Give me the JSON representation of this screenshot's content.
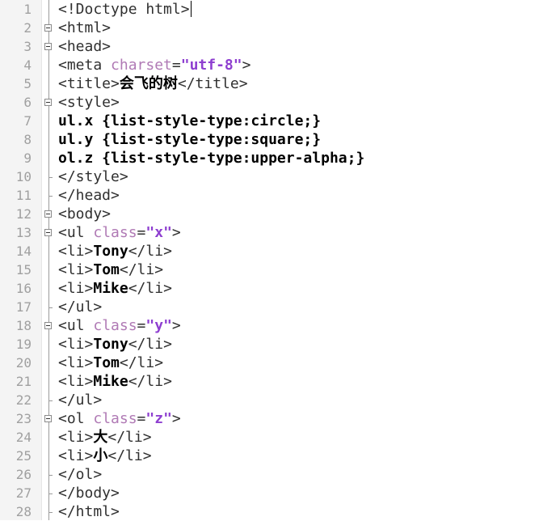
{
  "editor": {
    "lines": [
      {
        "n": "1",
        "parts": [
          {
            "t": "<!Doctype html>",
            "c": "tag"
          }
        ],
        "cursor": true
      },
      {
        "n": "2",
        "parts": [
          {
            "t": "<html>",
            "c": "tag"
          }
        ]
      },
      {
        "n": "3",
        "parts": [
          {
            "t": "<head>",
            "c": "tag"
          }
        ]
      },
      {
        "n": "4",
        "parts": [
          {
            "t": "<meta ",
            "c": "tag"
          },
          {
            "t": "charset",
            "c": "attr"
          },
          {
            "t": "=",
            "c": "tag"
          },
          {
            "t": "\"utf-8\"",
            "c": "val"
          },
          {
            "t": ">",
            "c": "tag"
          }
        ]
      },
      {
        "n": "5",
        "parts": [
          {
            "t": "<title>",
            "c": "tag"
          },
          {
            "t": "会飞的树",
            "c": "txt"
          },
          {
            "t": "</title>",
            "c": "tag"
          }
        ]
      },
      {
        "n": "6",
        "parts": [
          {
            "t": "<style>",
            "c": "tag"
          }
        ]
      },
      {
        "n": "7",
        "parts": [
          {
            "t": "ul.x {list-style-type:circle;}",
            "c": "css"
          }
        ]
      },
      {
        "n": "8",
        "parts": [
          {
            "t": "ul.y {list-style-type:square;}",
            "c": "css"
          }
        ]
      },
      {
        "n": "9",
        "parts": [
          {
            "t": "ol.z {list-style-type:upper-alpha;}",
            "c": "css"
          }
        ]
      },
      {
        "n": "10",
        "parts": [
          {
            "t": "</style>",
            "c": "tag"
          }
        ]
      },
      {
        "n": "11",
        "parts": [
          {
            "t": "</head>",
            "c": "tag"
          }
        ]
      },
      {
        "n": "12",
        "parts": [
          {
            "t": "<body>",
            "c": "tag"
          }
        ]
      },
      {
        "n": "13",
        "parts": [
          {
            "t": "<ul ",
            "c": "tag"
          },
          {
            "t": "class",
            "c": "attr"
          },
          {
            "t": "=",
            "c": "tag"
          },
          {
            "t": "\"x\"",
            "c": "val"
          },
          {
            "t": ">",
            "c": "tag"
          }
        ]
      },
      {
        "n": "14",
        "parts": [
          {
            "t": "<li>",
            "c": "tag"
          },
          {
            "t": "Tony",
            "c": "txt"
          },
          {
            "t": "</li>",
            "c": "tag"
          }
        ]
      },
      {
        "n": "15",
        "parts": [
          {
            "t": "<li>",
            "c": "tag"
          },
          {
            "t": "Tom",
            "c": "txt"
          },
          {
            "t": "</li>",
            "c": "tag"
          }
        ]
      },
      {
        "n": "16",
        "parts": [
          {
            "t": "<li>",
            "c": "tag"
          },
          {
            "t": "Mike",
            "c": "txt"
          },
          {
            "t": "</li>",
            "c": "tag"
          }
        ]
      },
      {
        "n": "17",
        "parts": [
          {
            "t": "</ul>",
            "c": "tag"
          }
        ]
      },
      {
        "n": "18",
        "parts": [
          {
            "t": "<ul ",
            "c": "tag"
          },
          {
            "t": "class",
            "c": "attr"
          },
          {
            "t": "=",
            "c": "tag"
          },
          {
            "t": "\"y\"",
            "c": "val"
          },
          {
            "t": ">",
            "c": "tag"
          }
        ]
      },
      {
        "n": "19",
        "parts": [
          {
            "t": "<li>",
            "c": "tag"
          },
          {
            "t": "Tony",
            "c": "txt"
          },
          {
            "t": "</li>",
            "c": "tag"
          }
        ]
      },
      {
        "n": "20",
        "parts": [
          {
            "t": "<li>",
            "c": "tag"
          },
          {
            "t": "Tom",
            "c": "txt"
          },
          {
            "t": "</li>",
            "c": "tag"
          }
        ]
      },
      {
        "n": "21",
        "parts": [
          {
            "t": "<li>",
            "c": "tag"
          },
          {
            "t": "Mike",
            "c": "txt"
          },
          {
            "t": "</li>",
            "c": "tag"
          }
        ]
      },
      {
        "n": "22",
        "parts": [
          {
            "t": "</ul>",
            "c": "tag"
          }
        ]
      },
      {
        "n": "23",
        "parts": [
          {
            "t": "<ol ",
            "c": "tag"
          },
          {
            "t": "class",
            "c": "attr"
          },
          {
            "t": "=",
            "c": "tag"
          },
          {
            "t": "\"z\"",
            "c": "val"
          },
          {
            "t": ">",
            "c": "tag"
          }
        ]
      },
      {
        "n": "24",
        "parts": [
          {
            "t": "<li>",
            "c": "tag"
          },
          {
            "t": "大",
            "c": "txt"
          },
          {
            "t": "</li>",
            "c": "tag"
          }
        ]
      },
      {
        "n": "25",
        "parts": [
          {
            "t": "<li>",
            "c": "tag"
          },
          {
            "t": "小",
            "c": "txt"
          },
          {
            "t": "</li>",
            "c": "tag"
          }
        ]
      },
      {
        "n": "26",
        "parts": [
          {
            "t": "</ol>",
            "c": "tag"
          }
        ]
      },
      {
        "n": "27",
        "parts": [
          {
            "t": "</body>",
            "c": "tag"
          }
        ]
      },
      {
        "n": "28",
        "parts": [
          {
            "t": "</html>",
            "c": "tag"
          }
        ]
      }
    ],
    "fold_open_lines": [
      "2",
      "3",
      "6",
      "12",
      "13",
      "18",
      "23"
    ],
    "fold_close_lines": [
      "10",
      "11",
      "17",
      "22",
      "26",
      "27",
      "28"
    ],
    "colors": {
      "tag": "#303030",
      "attr": "#b07ab5",
      "value": "#8e3fd0",
      "line_number": "#a0a0a0"
    }
  }
}
